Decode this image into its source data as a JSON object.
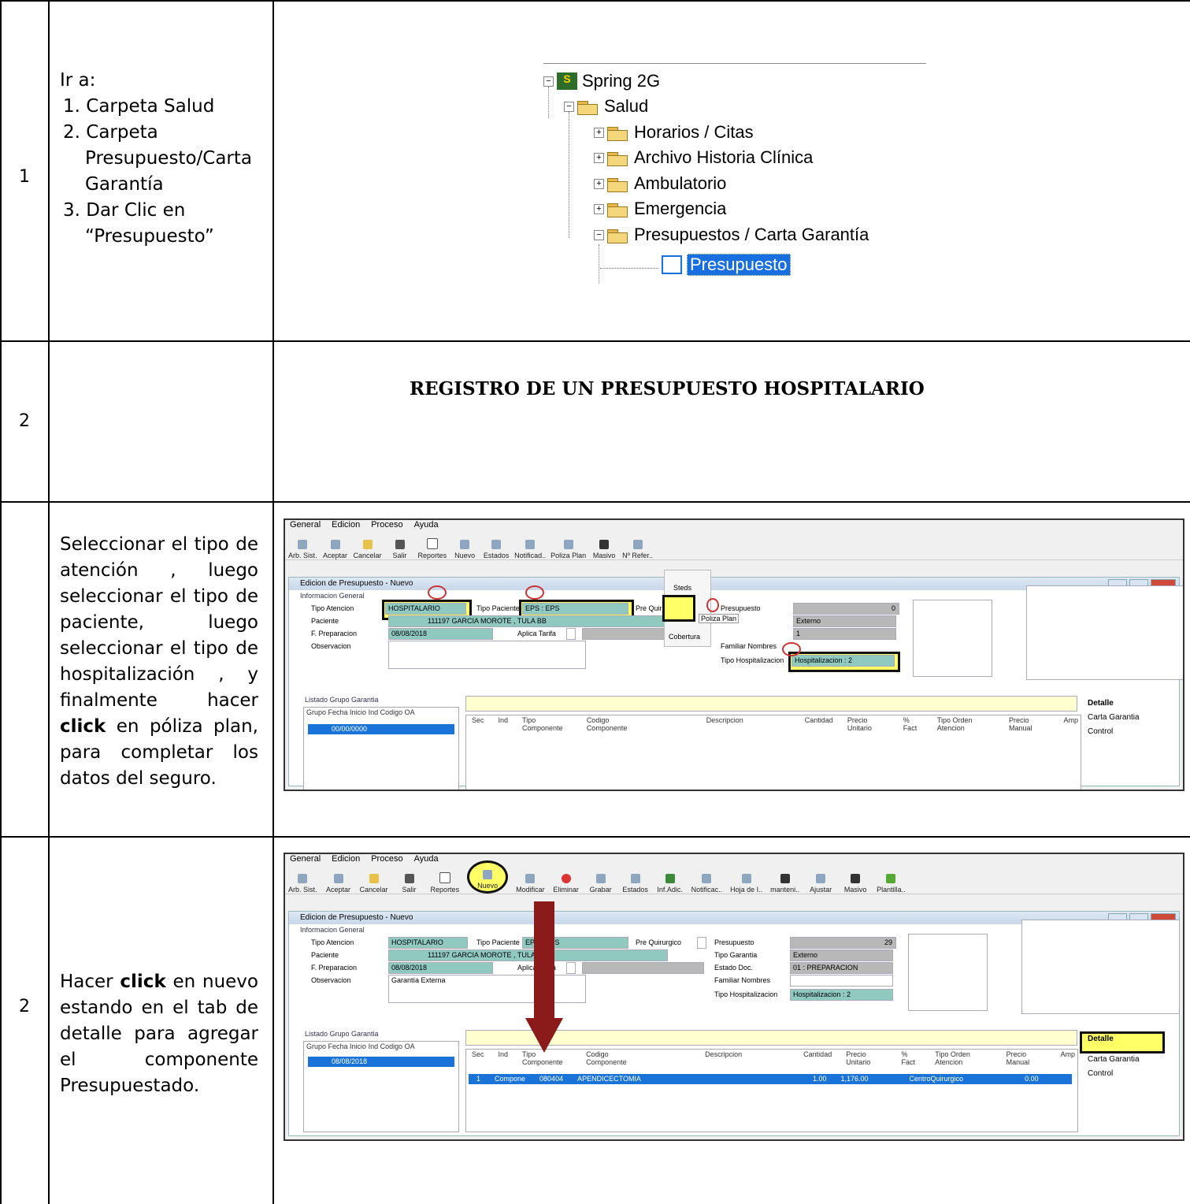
{
  "rows": [
    {
      "num": "1",
      "lines": [
        "Ir a:",
        "1. Carpeta Salud",
        "2. Carpeta",
        "Presupuesto/Carta",
        "Garantía",
        "3. Dar Clic en",
        "“Presupuesto”"
      ]
    },
    {
      "num": "2",
      "heading": "REGISTRO DE UN PRESUPUESTO HOSPITALARIO"
    },
    {
      "num": "",
      "text_parts": [
        "Seleccionar el tipo de atención , luego seleccionar el tipo de paciente, luego seleccionar el tipo de hospitalización , y finalmente hacer ",
        "click",
        " en póliza plan, para completar los datos del seguro."
      ]
    },
    {
      "num": "2",
      "text_parts": [
        "Hacer ",
        "click",
        " en nuevo estando en el tab de detalle para agregar el componente Presupuestado."
      ]
    }
  ],
  "tree": {
    "root": "Spring 2G",
    "salud": "Salud",
    "items": [
      "Horarios / Citas",
      "Archivo Historia Clínica",
      "Ambulatorio",
      "Emergencia",
      "Presupuestos / Carta Garantía"
    ],
    "selected": "Presupuesto"
  },
  "app": {
    "menu": [
      "General",
      "Edicion",
      "Proceso",
      "Ayuda"
    ],
    "toolbar1": [
      "Arb. Sist.",
      "Aceptar",
      "Cancelar",
      "Salir",
      "Reportes",
      "Nuevo",
      "Estados",
      "Notificad..",
      "Poliza Plan",
      "Masivo",
      "Nº Refer.."
    ],
    "toolbar2": [
      "Arb. Sist.",
      "Aceptar",
      "Cancelar",
      "Salir",
      "Reportes",
      "Nuevo",
      "Modificar",
      "Eliminar",
      "Grabar",
      "Estados",
      "Inf.Adic.",
      "Notificac..",
      "Hoja de I..",
      "manteni..",
      "Ajustar",
      "Masivo",
      "Plantilla.."
    ],
    "window_title": "Edicion de Presupuesto - Nuevo",
    "section": "Informacion General",
    "labels": {
      "tipo_atencion": "Tipo Atencion",
      "paciente": "Paciente",
      "f_preparacion": "F. Preparacion",
      "observacion": "Observacion",
      "tipo_paciente": "Tipo Paciente",
      "aplica_tarifa": "Aplica Tarifa",
      "pre_quirurgico": "Pre Quirurgico",
      "presupuesto": "Presupuesto",
      "tipo_garantia": "Tipo Garantia",
      "estado_doc": "Estado Doc.",
      "familiar_nombres": "Familiar Nombres",
      "tipo_hosp": "Tipo Hospitalizacion"
    },
    "values": {
      "tipo_atencion": "HOSPITALARIO",
      "tipo_paciente": "EPS : EPS",
      "paciente_id": "111197",
      "paciente_nombre": "GARCIA MOROTE , TULA BB",
      "fecha": "08/08/2018",
      "presupuesto1": "0",
      "presupuesto2": "29",
      "garantia": "Externo",
      "estado1": "1",
      "estado2": "01 : PREPARACION",
      "tipo_hosp": "Hospitalizacion : 2",
      "observacion2": "Garantía Externa"
    },
    "popup": [
      "Steds",
      "Poliza Plan",
      "Cobertura"
    ],
    "grid_title": "Listado Grupo Garantia",
    "grid_left_cols": [
      "Grupo",
      "Fecha Inicio",
      "Ind",
      "Codigo OA"
    ],
    "grid_left_date1": "00/00/0000",
    "grid_left_date2": "08/08/2018",
    "grid_cols": [
      "Sec",
      "Ind",
      "Tipo Componente",
      "Codigo Componente",
      "Descripcion",
      "Cantidad",
      "Precio Unitario",
      "% Fact",
      "Tipo Orden Atencion",
      "Precio Manual",
      "Amp"
    ],
    "grid_row": {
      "sec": "1",
      "tipo": "Compone",
      "codigo": "080404",
      "desc": "APENDICECTOMIA",
      "cantidad": "1.00",
      "precio": "1,176.00",
      "orden": "CentroQuirurgico",
      "manual": "0.00"
    },
    "side_tabs": [
      "Detalle",
      "Carta Garantia",
      "Control"
    ],
    "circles": [
      "1",
      "2",
      "3",
      "4"
    ]
  }
}
